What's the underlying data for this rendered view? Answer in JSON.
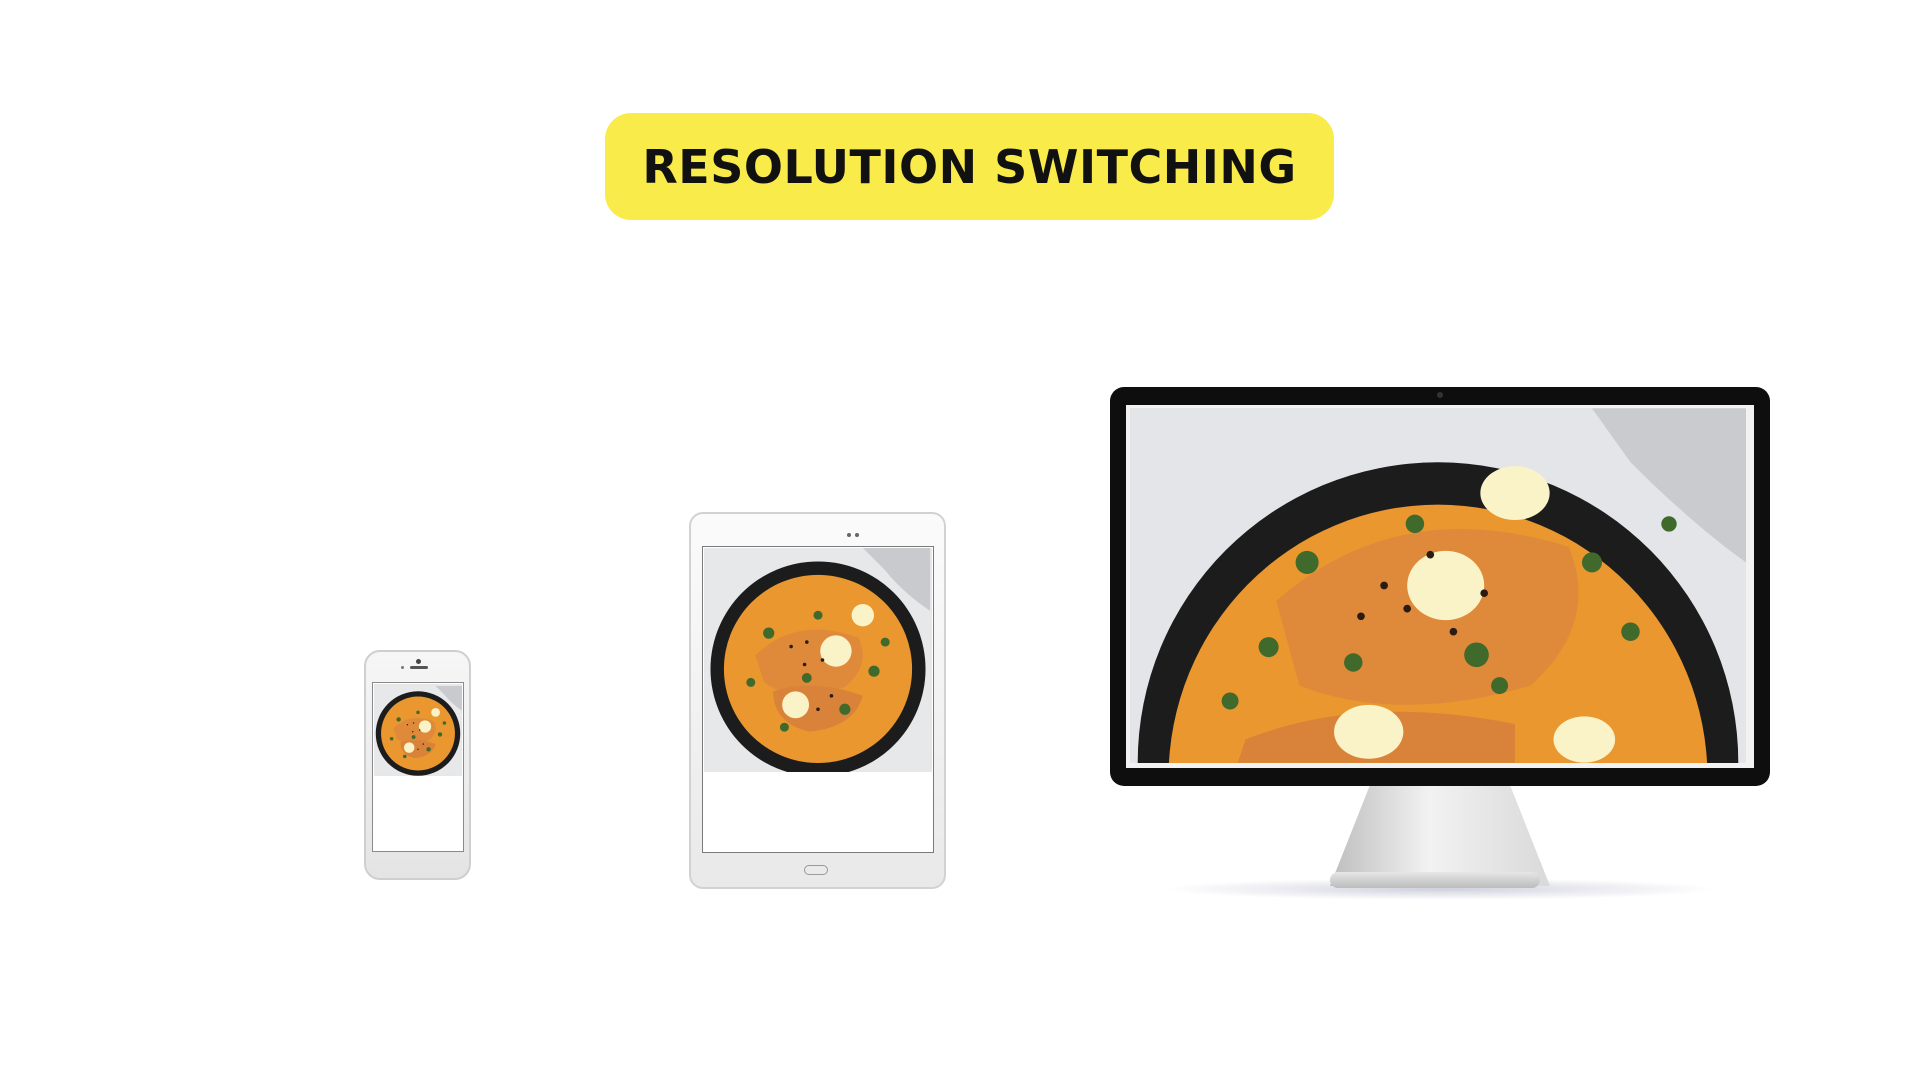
{
  "title": "RESOLUTION SWITCHING",
  "colors": {
    "accent": "#f9eb4a",
    "title_text": "#111111",
    "pan": "#1c1c1c",
    "sauce": "#e9972e",
    "salmon": "#de8a3a",
    "lemon": "#fbf3c8",
    "herb": "#3f6a2c",
    "background": "#ffffff"
  },
  "devices": [
    {
      "name": "phone",
      "image": "salmon-curry-pan-photo"
    },
    {
      "name": "tablet",
      "image": "salmon-curry-pan-photo"
    },
    {
      "name": "desktop-monitor",
      "image": "salmon-curry-pan-photo"
    }
  ]
}
